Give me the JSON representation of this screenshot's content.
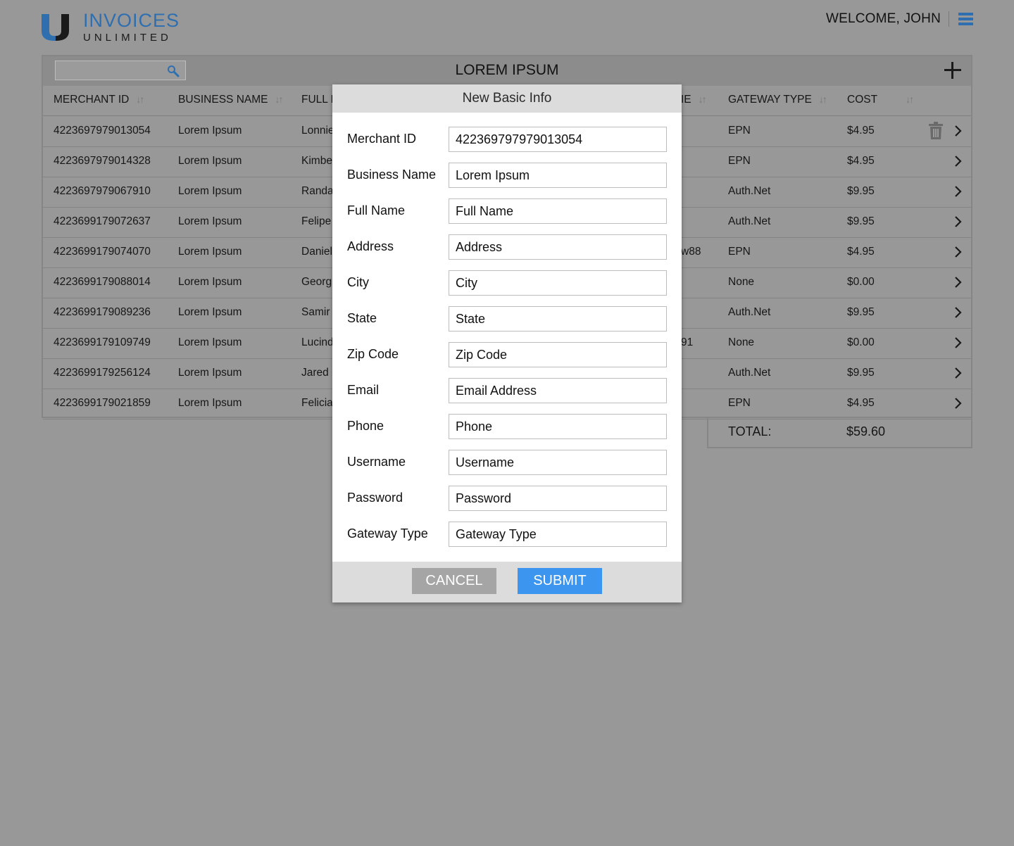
{
  "brand": {
    "name_top": "INVOICES",
    "name_bottom": "UNLIMITED",
    "accent": "#2f6fb0"
  },
  "header": {
    "welcome": "WELCOME, JOHN"
  },
  "panel": {
    "title": "LOREM IPSUM",
    "search_placeholder": ""
  },
  "table": {
    "headers": {
      "merchant_id": "MERCHANT ID",
      "business_name": "BUSINESS NAME",
      "full_name": "FULL N",
      "hidden_col": "IE",
      "gateway_type": "GATEWAY TYPE",
      "cost": "COST"
    },
    "rows": [
      {
        "merchant_id": "4223697979013054",
        "business": "Lorem Ipsum",
        "full_name": "Lonnie",
        "hidden": "",
        "gateway": "EPN",
        "cost": "$4.95"
      },
      {
        "merchant_id": "4223697979014328",
        "business": "Lorem Ipsum",
        "full_name": "Kimbe",
        "hidden": "",
        "gateway": "EPN",
        "cost": "$4.95"
      },
      {
        "merchant_id": "4223697979067910",
        "business": "Lorem Ipsum",
        "full_name": "Randa",
        "hidden": "",
        "gateway": "Auth.Net",
        "cost": "$9.95"
      },
      {
        "merchant_id": "4223699179072637",
        "business": "Lorem Ipsum",
        "full_name": "Felipe",
        "hidden": "",
        "gateway": "Auth.Net",
        "cost": "$9.95"
      },
      {
        "merchant_id": "4223699179074070",
        "business": "Lorem Ipsum",
        "full_name": "Daniel",
        "hidden": "w88",
        "gateway": "EPN",
        "cost": "$4.95"
      },
      {
        "merchant_id": "4223699179088014",
        "business": "Lorem Ipsum",
        "full_name": "Georg",
        "hidden": "",
        "gateway": "None",
        "cost": "$0.00"
      },
      {
        "merchant_id": "4223699179089236",
        "business": "Lorem Ipsum",
        "full_name": "Samir",
        "hidden": "",
        "gateway": "Auth.Net",
        "cost": "$9.95"
      },
      {
        "merchant_id": "4223699179109749",
        "business": "Lorem Ipsum",
        "full_name": "Lucind",
        "hidden": "91",
        "gateway": "None",
        "cost": "$0.00"
      },
      {
        "merchant_id": "4223699179256124",
        "business": "Lorem Ipsum",
        "full_name": "Jared S",
        "hidden": "",
        "gateway": "Auth.Net",
        "cost": "$9.95"
      },
      {
        "merchant_id": "4223699179021859",
        "business": "Lorem Ipsum",
        "full_name": "Felicia",
        "hidden": "",
        "gateway": "EPN",
        "cost": "$4.95"
      }
    ],
    "total_label": "TOTAL:",
    "total_value": "$59.60"
  },
  "modal": {
    "title": "New Basic Info",
    "fields": [
      {
        "label": "Merchant ID",
        "value": "422369797979013054",
        "placeholder": ""
      },
      {
        "label": "Business Name",
        "value": "Lorem Ipsum",
        "placeholder": ""
      },
      {
        "label": "Full Name",
        "value": "",
        "placeholder": "Full Name"
      },
      {
        "label": "Address",
        "value": "",
        "placeholder": "Address"
      },
      {
        "label": "City",
        "value": "",
        "placeholder": "City"
      },
      {
        "label": "State",
        "value": "",
        "placeholder": "State"
      },
      {
        "label": "Zip Code",
        "value": "",
        "placeholder": "Zip Code"
      },
      {
        "label": "Email",
        "value": "",
        "placeholder": "Email Address"
      },
      {
        "label": "Phone",
        "value": "",
        "placeholder": "Phone"
      },
      {
        "label": "Username",
        "value": "",
        "placeholder": "Username"
      },
      {
        "label": "Password",
        "value": "",
        "placeholder": "Password"
      },
      {
        "label": "Gateway Type",
        "value": "",
        "placeholder": "Gateway Type"
      }
    ],
    "cancel_label": "CANCEL",
    "submit_label": "SUBMIT",
    "submit_color": "#3c95ef"
  }
}
